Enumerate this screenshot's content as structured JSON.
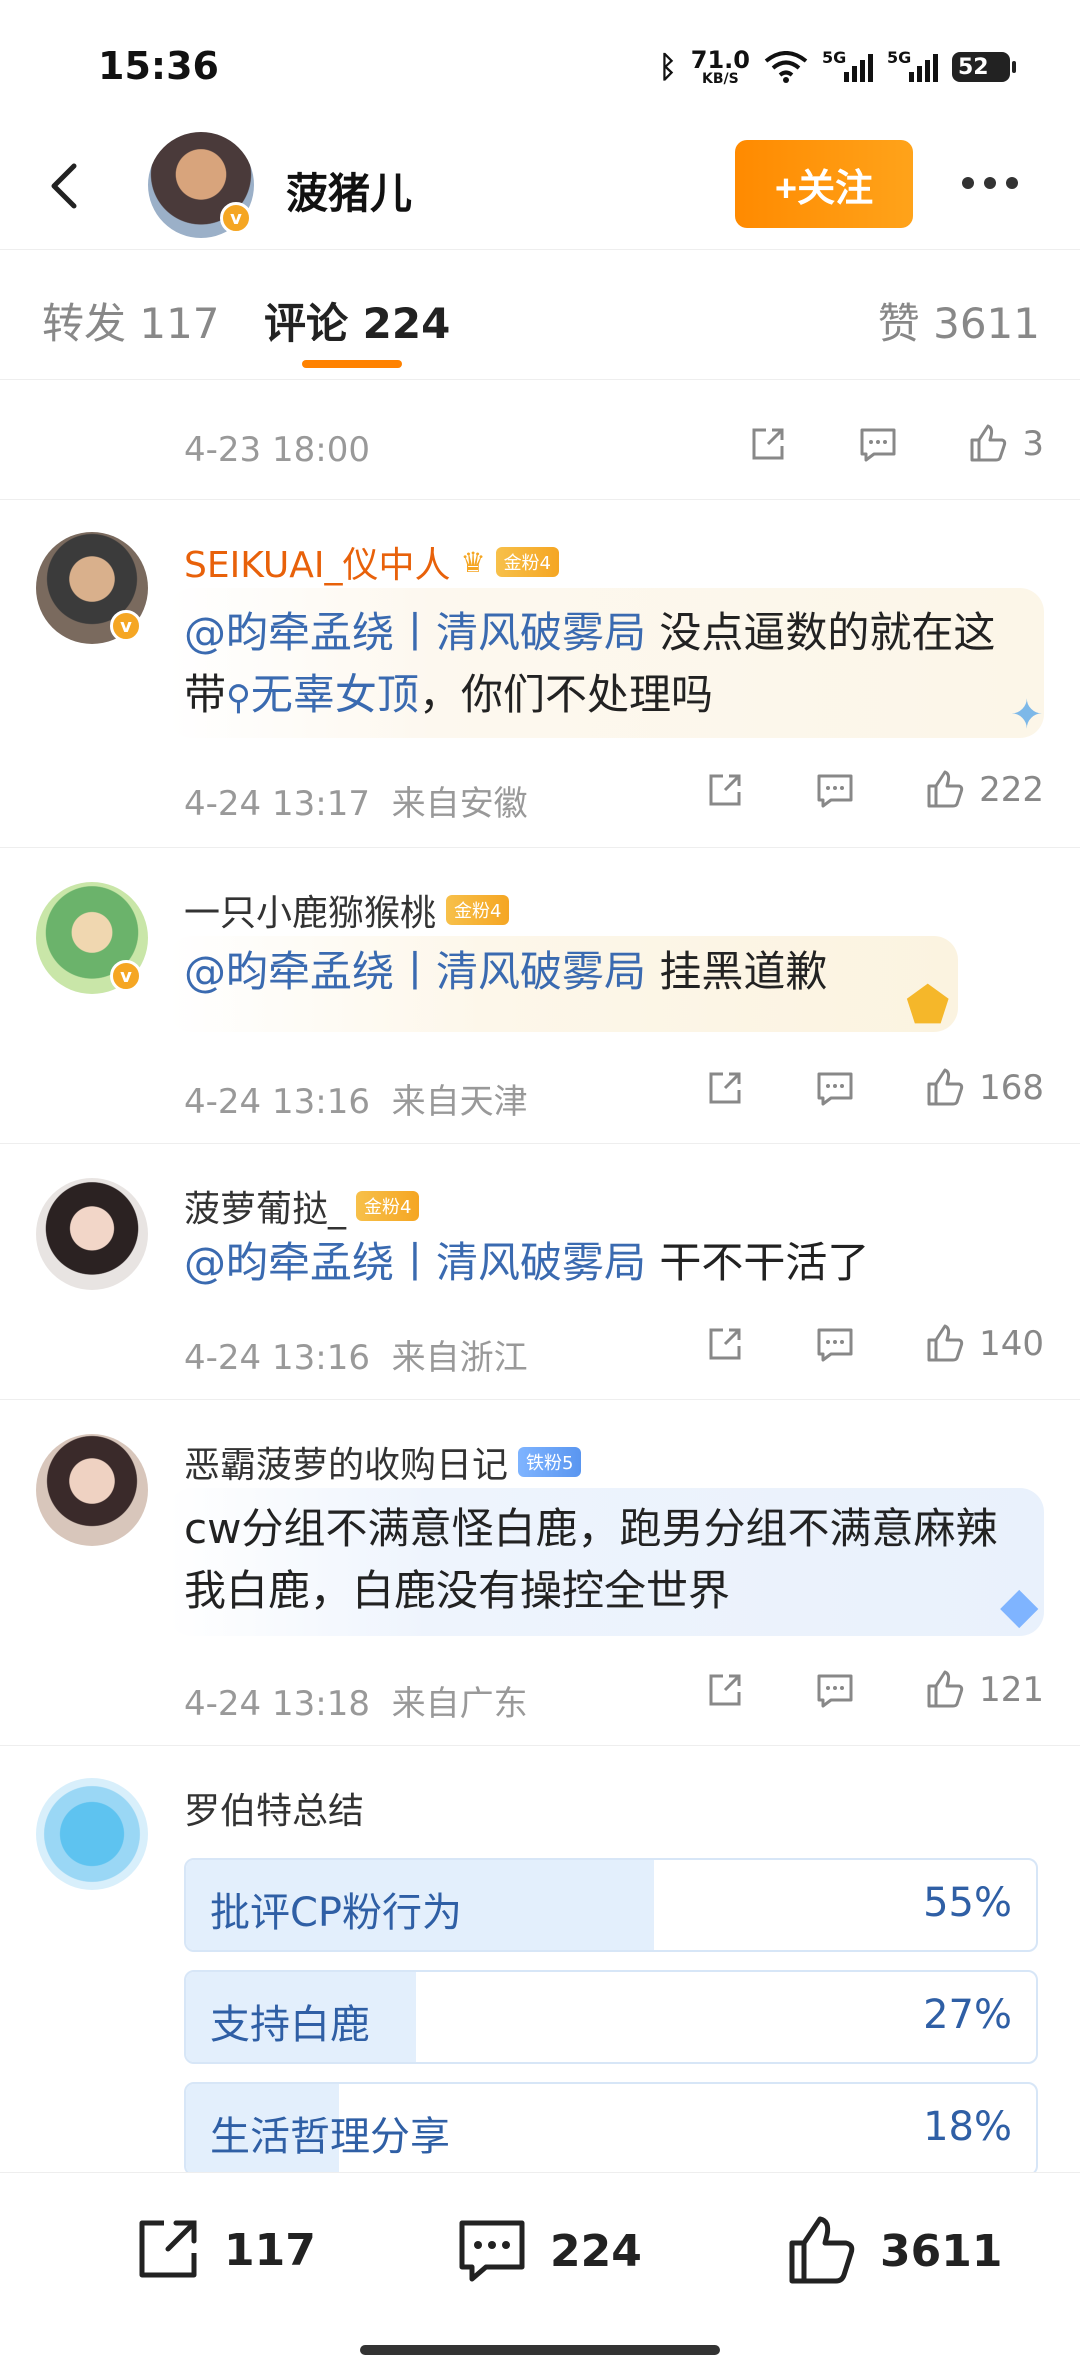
{
  "status": {
    "time": "15:36",
    "speed_value": "71.0",
    "speed_unit": "KB/S",
    "net1": "5G",
    "net2": "5G",
    "battery": "52"
  },
  "header": {
    "name": "菠猪儿",
    "follow_label": "+关注"
  },
  "tabs": [
    {
      "label": "转发 117"
    },
    {
      "label": "评论 224"
    },
    {
      "label": "赞 3611"
    }
  ],
  "post_meta": {
    "time": "4-23 18:00",
    "likes": "3"
  },
  "comments": [
    {
      "name": "SEIKUAI_仪中人",
      "fan": "金粉4",
      "mention": "@昀牵孟绕丨清风破雾局",
      "text": " 没点逼数的就在这带",
      "topic": "无辜女顶",
      "text2": "，你们不处理吗",
      "time": "4-24 13:17",
      "location": "来自安徽",
      "likes": "222"
    },
    {
      "name": "一只小鹿猕猴桃",
      "fan": "金粉4",
      "mention": "@昀牵孟绕丨清风破雾局",
      "text": " 挂黑道歉",
      "time": "4-24 13:16",
      "location": "来自天津",
      "likes": "168"
    },
    {
      "name": "菠萝葡挞_",
      "fan": "金粉4",
      "mention": "@昀牵孟绕丨清风破雾局",
      "text": " 干不干活了",
      "time": "4-24 13:16",
      "location": "来自浙江",
      "likes": "140"
    },
    {
      "name": "恶霸菠萝的收购日记",
      "fan": "铁粉5",
      "text": "cw分组不满意怪白鹿，跑男分组不满意麻辣我白鹿，白鹿没有操控全世界",
      "time": "4-24 13:18",
      "location": "来自广东",
      "likes": "121"
    }
  ],
  "poll": {
    "name": "罗伯特总结",
    "options": [
      {
        "label": "批评CP粉行为",
        "pct": "55%",
        "value": 55
      },
      {
        "label": "支持白鹿",
        "pct": "27%",
        "value": 27
      },
      {
        "label": "生活哲理分享",
        "pct": "18%",
        "value": 18
      }
    ]
  },
  "bottom": {
    "reposts": "117",
    "comments": "224",
    "likes": "3611"
  }
}
